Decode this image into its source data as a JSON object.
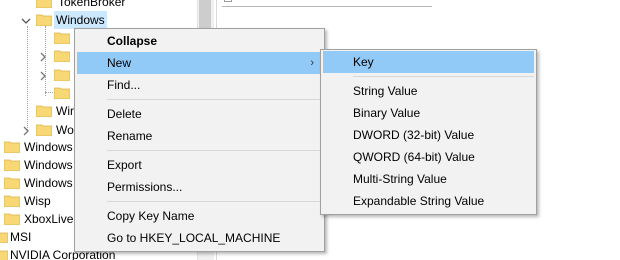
{
  "tree": {
    "rows": [
      {
        "label": "TokenBroker"
      },
      {
        "label": "Windows"
      },
      {
        "label": ""
      },
      {
        "label": ""
      },
      {
        "label": ""
      },
      {
        "label": ""
      },
      {
        "label": "Wir"
      },
      {
        "label": "Wo"
      },
      {
        "label": "Windows"
      },
      {
        "label": "Windows"
      },
      {
        "label": "Windows"
      },
      {
        "label": "Wisp"
      },
      {
        "label": "XboxLive"
      },
      {
        "label": "MSI"
      },
      {
        "label": "NVIDIA Corporation"
      }
    ]
  },
  "context_menu": {
    "items": [
      {
        "label": "Collapse"
      },
      {
        "label": "New"
      },
      {
        "label": "Find..."
      },
      {
        "label": "Delete"
      },
      {
        "label": "Rename"
      },
      {
        "label": "Export"
      },
      {
        "label": "Permissions..."
      },
      {
        "label": "Copy Key Name"
      },
      {
        "label": "Go to HKEY_LOCAL_MACHINE"
      }
    ],
    "submenu_arrow": "›"
  },
  "new_submenu": {
    "items": [
      {
        "label": "Key"
      },
      {
        "label": "String Value"
      },
      {
        "label": "Binary Value"
      },
      {
        "label": "DWORD (32-bit) Value"
      },
      {
        "label": "QWORD (64-bit) Value"
      },
      {
        "label": "Multi-String Value"
      },
      {
        "label": "Expandable String Value"
      }
    ]
  },
  "colors": {
    "menu_background": "#f2f2f2",
    "menu_hover": "#91c9f7",
    "tree_selection": "#cce8ff",
    "folder": "#f8d775"
  },
  "icons": {
    "folder": "folder-icon",
    "expand": "chevron-right-icon",
    "collapse": "chevron-down-icon"
  }
}
